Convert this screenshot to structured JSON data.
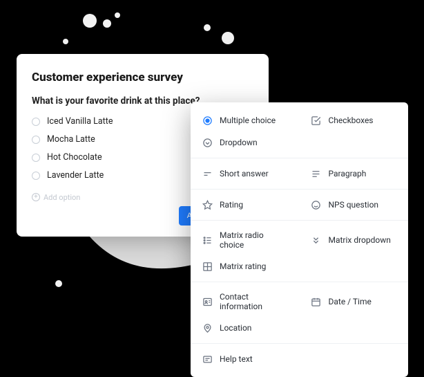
{
  "survey": {
    "title": "Customer experience survey",
    "question": "What is your favorite drink at this place?",
    "options": [
      {
        "label": "Iced Vanilla Latte"
      },
      {
        "label": "Mocha Latte"
      },
      {
        "label": "Hot Chocolate"
      },
      {
        "label": "Lavender Latte"
      }
    ],
    "add_option_label": "Add option",
    "add_question_label": "Add question"
  },
  "menu": {
    "groups": [
      [
        {
          "key": "multiple-choice",
          "label": "Multiple choice",
          "active": true
        },
        {
          "key": "checkboxes",
          "label": "Checkboxes"
        },
        {
          "key": "dropdown",
          "label": "Dropdown"
        }
      ],
      [
        {
          "key": "short-answer",
          "label": "Short answer"
        },
        {
          "key": "paragraph",
          "label": "Paragraph"
        }
      ],
      [
        {
          "key": "rating",
          "label": "Rating"
        },
        {
          "key": "nps",
          "label": "NPS question"
        }
      ],
      [
        {
          "key": "matrix-radio",
          "label": "Matrix radio choice"
        },
        {
          "key": "matrix-dropdown",
          "label": "Matrix dropdown"
        },
        {
          "key": "matrix-rating",
          "label": "Matrix rating"
        }
      ],
      [
        {
          "key": "contact",
          "label": "Contact information"
        },
        {
          "key": "datetime",
          "label": "Date / Time"
        },
        {
          "key": "location",
          "label": "Location"
        }
      ],
      [
        {
          "key": "help-text",
          "label": "Help text"
        }
      ]
    ]
  }
}
